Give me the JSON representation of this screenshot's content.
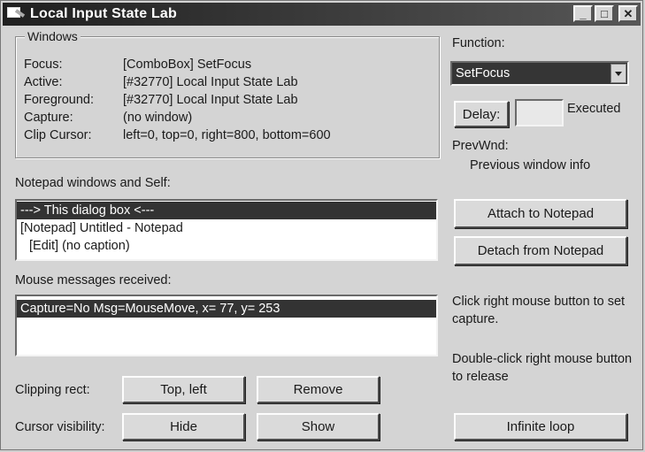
{
  "window": {
    "title": "Local Input State Lab"
  },
  "windows_group": {
    "title": "Windows",
    "rows": [
      {
        "label": "Focus:",
        "value": "[ComboBox] SetFocus"
      },
      {
        "label": "Active:",
        "value": "[#32770] Local Input State Lab"
      },
      {
        "label": "Foreground:",
        "value": "[#32770] Local Input State Lab"
      },
      {
        "label": "Capture:",
        "value": "(no window)"
      },
      {
        "label": "Clip Cursor:",
        "value": "left=0, top=0, right=800, bottom=600"
      }
    ]
  },
  "function": {
    "label": "Function:",
    "selected": "SetFocus",
    "delay_label": "Delay:",
    "delay_value": "",
    "executed_label": "Executed",
    "prevwnd_label": "PrevWnd:",
    "prevwnd_info": "Previous window info"
  },
  "notepad": {
    "label": "Notepad windows and Self:",
    "items": [
      "---> This dialog box <---",
      "[Notepad] Untitled - Notepad",
      "[Edit] (no caption)"
    ],
    "attach_button": "Attach to Notepad",
    "detach_button": "Detach from Notepad"
  },
  "mouse": {
    "label": "Mouse messages received:",
    "items": [
      "Capture=No   Msg=MouseMove,  x=   77, y=  253"
    ],
    "hint_capture": "Click right mouse button to set capture.",
    "hint_release": "Double-click right mouse button to release"
  },
  "clipping": {
    "label": "Clipping rect:",
    "topleft_button": "Top, left",
    "remove_button": "Remove"
  },
  "cursor": {
    "label": "Cursor visibility:",
    "hide_button": "Hide",
    "show_button": "Show",
    "infinite_button": "Infinite loop"
  }
}
